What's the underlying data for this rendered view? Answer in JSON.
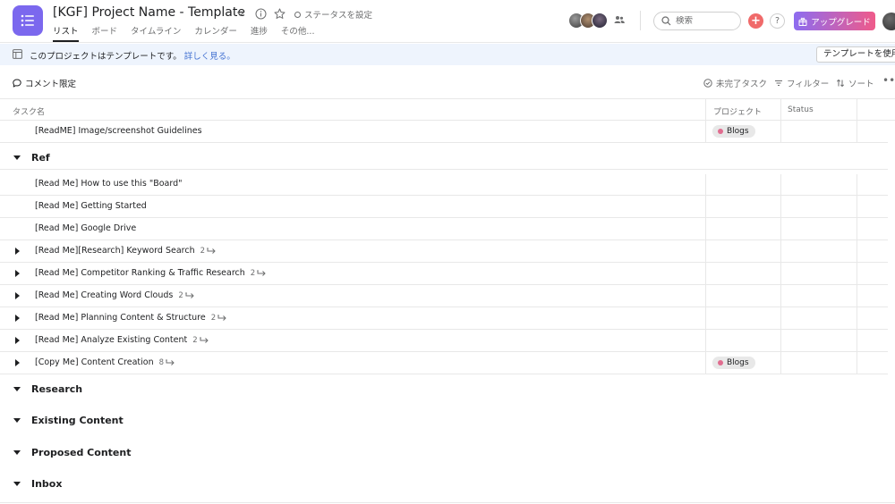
{
  "header": {
    "title": "[KGF] Project Name - Template",
    "status_label": "ステータスを設定",
    "tabs": [
      {
        "label": "リスト",
        "active": true
      },
      {
        "label": "ボード",
        "active": false
      },
      {
        "label": "タイムライン",
        "active": false
      },
      {
        "label": "カレンダー",
        "active": false
      },
      {
        "label": "進捗",
        "active": false
      },
      {
        "label": "その他...",
        "active": false
      }
    ],
    "search_placeholder": "検索",
    "upgrade_label": "アップグレード",
    "help_label": "?"
  },
  "banner": {
    "text": "このプロジェクトはテンプレートです。",
    "link": "詳しく見る。",
    "use_template": "テンプレートを使用"
  },
  "toolbar": {
    "comment_only": "コメント限定",
    "incomplete_tasks": "未完了タスク",
    "filter": "フィルター",
    "sort": "ソート"
  },
  "columns": {
    "task_name": "タスク名",
    "project": "プロジェクト",
    "status": "Status"
  },
  "rows": {
    "top": {
      "name": "[ReadME] Image/screenshot Guidelines",
      "project": "Blogs"
    },
    "ref_section": "Ref",
    "ref_tasks": [
      {
        "name": "[Read Me] How to use this \"Board\"",
        "subtasks": "",
        "project": ""
      },
      {
        "name": "[Read Me] Getting Started",
        "subtasks": "",
        "project": ""
      },
      {
        "name": "[Read Me] Google Drive",
        "subtasks": "",
        "project": ""
      },
      {
        "name": "[Read Me][Research] Keyword Search",
        "subtasks": "2",
        "project": ""
      },
      {
        "name": "[Read Me] Competitor Ranking & Traffic Research",
        "subtasks": "2",
        "project": ""
      },
      {
        "name": "[Read Me] Creating Word Clouds",
        "subtasks": "2",
        "project": ""
      },
      {
        "name": "[Read Me] Planning Content & Structure",
        "subtasks": "2",
        "project": ""
      },
      {
        "name": "[Read Me] Analyze Existing Content",
        "subtasks": "2",
        "project": ""
      },
      {
        "name": "[Copy Me] Content Creation",
        "subtasks": "8",
        "project": "Blogs"
      }
    ],
    "sections": [
      "Research",
      "Existing Content",
      "Proposed Content",
      "Inbox"
    ]
  },
  "colors": {
    "app_icon": "#7b68ee",
    "plus": "#f06a6a",
    "pill_dot": "#e06c8f",
    "link": "#4573d2",
    "banner_bg": "#eef4fd"
  }
}
